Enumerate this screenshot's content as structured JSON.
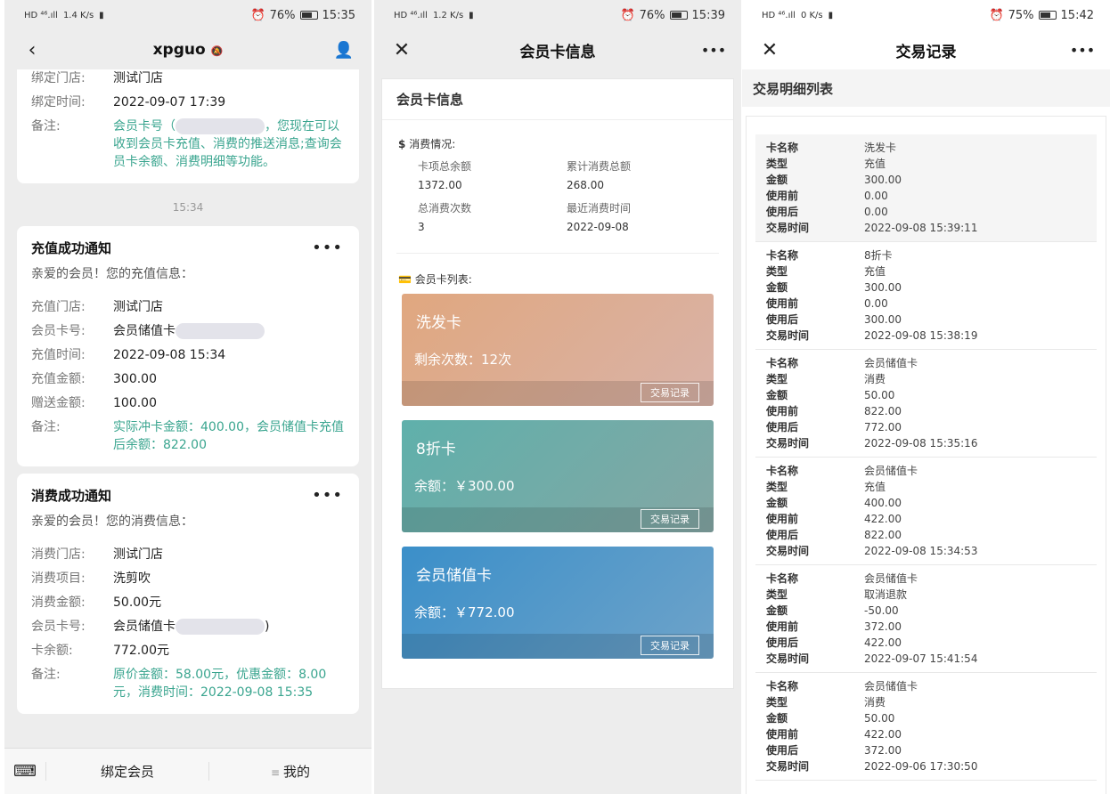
{
  "p1": {
    "status": {
      "left": "HD ⁴⁶.ıll",
      "speed": "1.4 K/s",
      "battery": "76%",
      "battery_fill": 0.76,
      "time": "15:35"
    },
    "title": "xpguo",
    "card1": {
      "store_label": "绑定门店:",
      "store": "测试门店",
      "time_label": "绑定时间:",
      "time": "2022-09-07 17:39",
      "note_label": "备注:",
      "note_a": "会员卡号（",
      "note_b": "，您现在可以收到会员卡充值、消费的推送消息;查询会员卡余额、消费明细等功能。"
    },
    "timestamp": "15:34",
    "recharge": {
      "title": "充值成功通知",
      "sub": "亲爱的会员！您的充值信息：",
      "rows": [
        {
          "l": "充值门店:",
          "v": "测试门店"
        },
        {
          "l": "会员卡号:",
          "v": "会员储值卡"
        },
        {
          "l": "充值时间:",
          "v": "2022-09-08 15:34"
        },
        {
          "l": "充值金额:",
          "v": "300.00"
        },
        {
          "l": "赠送金额:",
          "v": "100.00"
        }
      ],
      "note_label": "备注:",
      "note": "实际冲卡金额：400.00，会员储值卡充值后余额：822.00"
    },
    "consume": {
      "title": "消费成功通知",
      "sub": "亲爱的会员！您的消费信息：",
      "rows": [
        {
          "l": "消费门店:",
          "v": "测试门店"
        },
        {
          "l": "消费项目:",
          "v": "洗剪吹"
        },
        {
          "l": "消费金额:",
          "v": "50.00元"
        },
        {
          "l": "会员卡号:",
          "v": "会员储值卡"
        },
        {
          "l": "卡余额:",
          "v": "772.00元"
        }
      ],
      "note_label": "备注:",
      "note": "原价金额：58.00元，优惠金额：8.00元，消费时间：2022-09-08 15:35"
    },
    "bottom": {
      "bind": "绑定会员",
      "mine": "我的"
    }
  },
  "p2": {
    "status": {
      "left": "HD ⁴⁶.ıll",
      "speed": "1.2 K/s",
      "battery": "76%",
      "battery_fill": 0.76,
      "time": "15:39"
    },
    "title": "会员卡信息",
    "box_title": "会员卡信息",
    "consume_title": "消费情况:",
    "stats": [
      {
        "l": "卡项总余额",
        "v": "1372.00"
      },
      {
        "l": "累计消费总额",
        "v": "268.00"
      },
      {
        "l": "总消费次数",
        "v": "3"
      },
      {
        "l": "最近消费时间",
        "v": "2022-09-08"
      }
    ],
    "list_title": "会员卡列表:",
    "record_label": "交易记录",
    "cards": [
      {
        "name": "洗发卡",
        "balance": "剩余次数：12次",
        "gradient": [
          "#e0a77f",
          "#d9b3a8"
        ]
      },
      {
        "name": "8折卡",
        "balance": "余额：￥300.00",
        "gradient": [
          "#5fb0ab",
          "#84a7a4"
        ]
      },
      {
        "name": "会员储值卡",
        "balance": "余额：￥772.00",
        "gradient": [
          "#3b8fc9",
          "#6ea3c9"
        ]
      }
    ]
  },
  "p3": {
    "status": {
      "left": "HD ⁴⁶.ıll",
      "speed": "0 K/s",
      "battery": "75%",
      "battery_fill": 0.75,
      "time": "15:42"
    },
    "title": "交易记录",
    "list_header": "交易明细列表",
    "keys": {
      "name": "卡名称",
      "type": "类型",
      "amount": "金额",
      "before": "使用前",
      "after": "使用后",
      "time": "交易时间"
    },
    "transactions": [
      {
        "name": "洗发卡",
        "type": "充值",
        "amount": "300.00",
        "before": "0.00",
        "after": "0.00",
        "time": "2022-09-08 15:39:11"
      },
      {
        "name": "8折卡",
        "type": "充值",
        "amount": "300.00",
        "before": "0.00",
        "after": "300.00",
        "time": "2022-09-08 15:38:19"
      },
      {
        "name": "会员储值卡",
        "type": "消费",
        "amount": "50.00",
        "before": "822.00",
        "after": "772.00",
        "time": "2022-09-08 15:35:16"
      },
      {
        "name": "会员储值卡",
        "type": "充值",
        "amount": "400.00",
        "before": "422.00",
        "after": "822.00",
        "time": "2022-09-08 15:34:53"
      },
      {
        "name": "会员储值卡",
        "type": "取消退款",
        "amount": "-50.00",
        "before": "372.00",
        "after": "422.00",
        "time": "2022-09-07 15:41:54"
      },
      {
        "name": "会员储值卡",
        "type": "消费",
        "amount": "50.00",
        "before": "422.00",
        "after": "372.00",
        "time": "2022-09-06 17:30:50"
      }
    ]
  }
}
